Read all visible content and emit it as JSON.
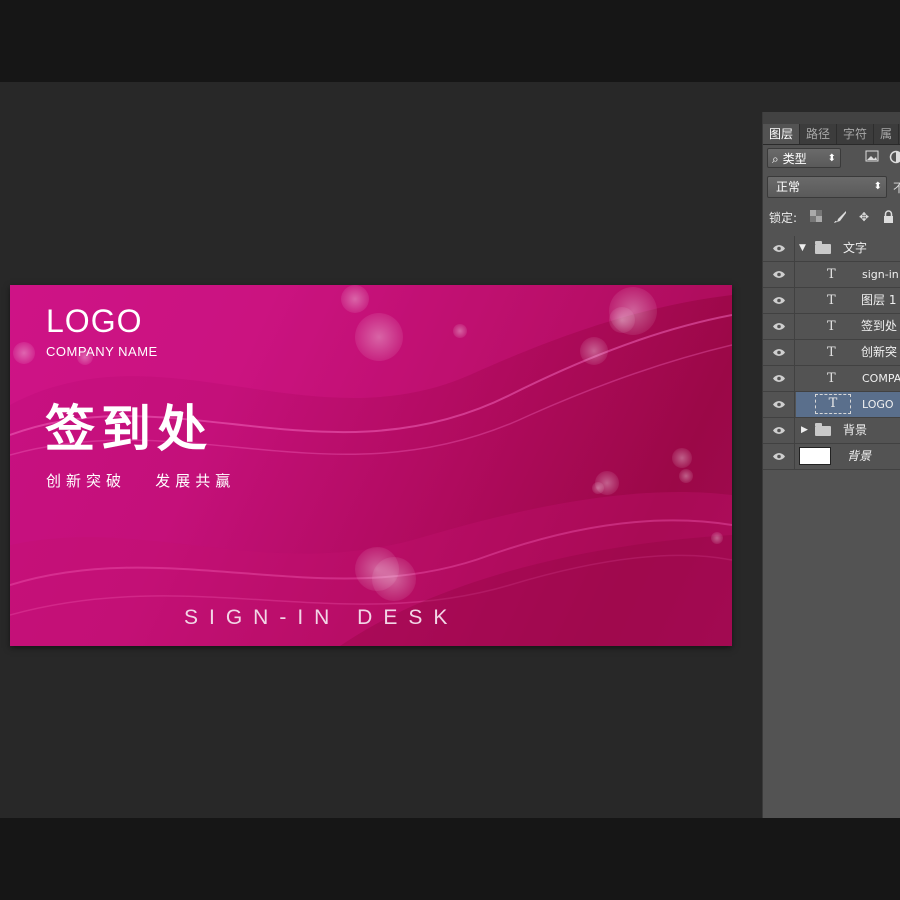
{
  "canvas": {
    "logo": "LOGO",
    "company": "COMPANY NAME",
    "title": "签到处",
    "slogan": "创新突破   发展共赢",
    "signin": "SIGN-IN DESK"
  },
  "panel": {
    "tabs": [
      "图层",
      "路径",
      "字符",
      "属"
    ],
    "filter": {
      "label": "类型",
      "icon": "search-icon"
    },
    "blend_mode": "正常",
    "opacity_cut": "不",
    "lock_label": "锁定:",
    "layers": [
      {
        "name": "文字",
        "type": "group",
        "expanded": true
      },
      {
        "name": "sign-in",
        "type": "text"
      },
      {
        "name": "图层 1",
        "type": "text"
      },
      {
        "name": "签到处",
        "type": "text"
      },
      {
        "name": "创新突",
        "type": "text"
      },
      {
        "name": "COMPA",
        "type": "text"
      },
      {
        "name": "LOGO",
        "type": "text",
        "selected": true
      },
      {
        "name": "背景",
        "type": "group",
        "expanded": false
      },
      {
        "name": "背景",
        "type": "background"
      }
    ]
  },
  "colors": {
    "banner_accent": "#c81082",
    "panel_bg": "#535353",
    "selected_layer": "#5a6f8c"
  }
}
